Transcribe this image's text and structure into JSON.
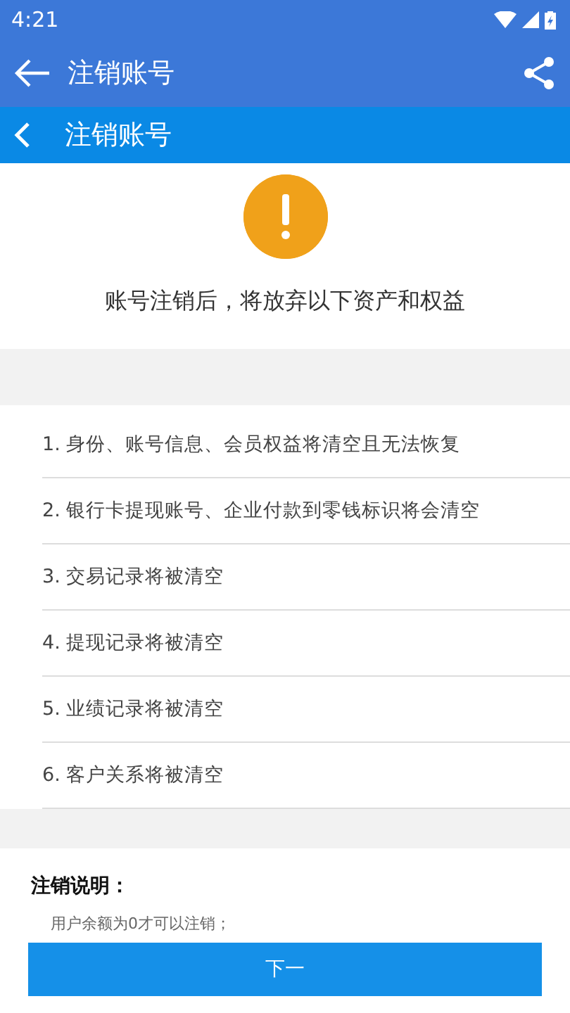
{
  "status_bar": {
    "time": "4:21"
  },
  "toolbar": {
    "title": "注销账号"
  },
  "subheader": {
    "title": "注销账号"
  },
  "notice": {
    "text": "账号注销后，将放弃以下资产和权益"
  },
  "items": [
    {
      "text": "1. 身份、账号信息、会员权益将清空且无法恢复"
    },
    {
      "text": "2. 银行卡提现账号、企业付款到零钱标识将会清空"
    },
    {
      "text": "3. 交易记录将被清空"
    },
    {
      "text": "4. 提现记录将被清空"
    },
    {
      "text": "5. 业绩记录将被清空"
    },
    {
      "text": "6. 客户关系将被清空"
    }
  ],
  "explanation": {
    "title": "注销说明：",
    "lines": [
      "用户余额为0才可以注销；"
    ]
  },
  "next_button": {
    "label": "下一"
  }
}
